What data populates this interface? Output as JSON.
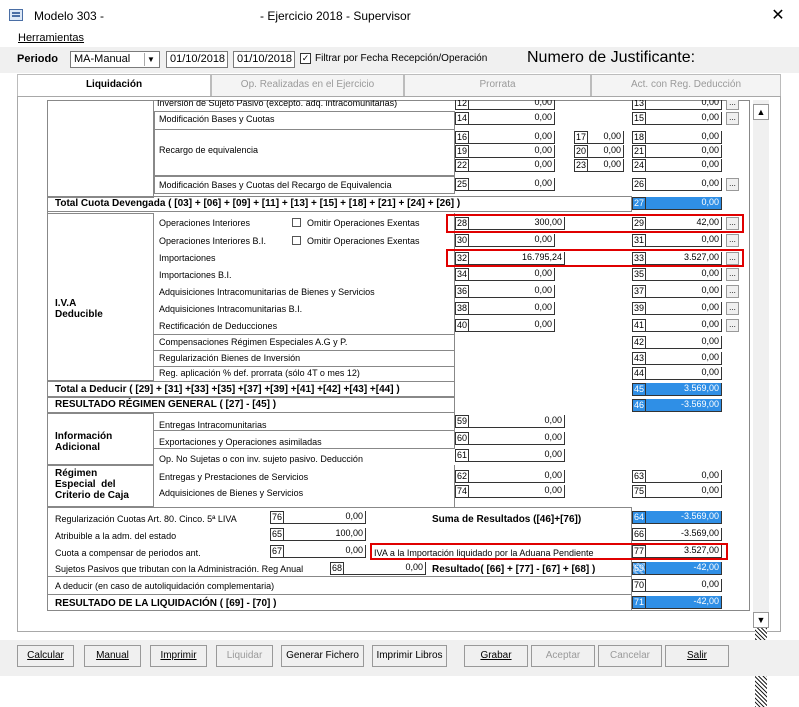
{
  "window": {
    "app_title": "Modelo 303 -",
    "title": "- Ejercicio 2018 - Supervisor",
    "close": "✕"
  },
  "menu": {
    "tools": "Herramientas"
  },
  "toolbar": {
    "period_label": "Periodo",
    "period_value": "MA-Manual",
    "date_from": "01/10/2018",
    "date_to": "01/10/2018",
    "filter_label": "Filtrar por Fecha Recepción/Operación",
    "filter_checked": "✓",
    "justificante_label": "Numero de Justificante:"
  },
  "tabs": [
    "Liquidación",
    "Op. Realizadas en el Ejercicio",
    "Prorrata",
    "Act. con Reg. Deducción"
  ],
  "rows": {
    "r1": {
      "label": "Inversión de Sujeto Pasivo (excepto. adq. intracomunitarias)",
      "a": "12",
      "av": "0,00",
      "b": "13",
      "bv": "0,00"
    },
    "r2": {
      "label": "Modificación Bases y Cuotas",
      "a": "14",
      "av": "0,00",
      "b": "15",
      "bv": "0,00"
    },
    "r3": {
      "label": "Recargo de equivalencia",
      "lines": [
        {
          "a": "16",
          "av": "0,00",
          "m": "17",
          "mv": "0,00",
          "b": "18",
          "bv": "0,00"
        },
        {
          "a": "19",
          "av": "0,00",
          "m": "20",
          "mv": "0,00",
          "b": "21",
          "bv": "0,00"
        },
        {
          "a": "22",
          "av": "0,00",
          "m": "23",
          "mv": "0,00",
          "b": "24",
          "bv": "0,00"
        }
      ]
    },
    "r4": {
      "label": "Modificación Bases y Cuotas del Recargo de Equivalencia",
      "a": "25",
      "av": "0,00",
      "b": "26",
      "bv": "0,00"
    },
    "total_dev": {
      "label": "Total Cuota Devengada ( [03] + [06] + [09] + [11] + [13] + [15] + [18] + [21] + [24] + [26] )",
      "b": "27",
      "bv": "0,00"
    },
    "ded_group": "I.V.A\nDeducible",
    "d1": {
      "label": "Operaciones Interiores",
      "omit": "Omitir Operaciones Exentas",
      "a": "28",
      "av": "300,00",
      "b": "29",
      "bv": "42,00"
    },
    "d2": {
      "label": "Operaciones Interiores B.I.",
      "omit": "Omitir Operaciones Exentas",
      "a": "30",
      "av": "0,00",
      "b": "31",
      "bv": "0,00"
    },
    "d3": {
      "label": "Importaciones",
      "a": "32",
      "av": "16.795,24",
      "b": "33",
      "bv": "3.527,00"
    },
    "d4": {
      "label": "Importaciones B.I.",
      "a": "34",
      "av": "0,00",
      "b": "35",
      "bv": "0,00"
    },
    "d5": {
      "label": "Adquisiciones Intracomunitarias de Bienes y Servicios",
      "a": "36",
      "av": "0,00",
      "b": "37",
      "bv": "0,00"
    },
    "d6": {
      "label": "Adquisiciones Intracomunitarias B.I.",
      "a": "38",
      "av": "0,00",
      "b": "39",
      "bv": "0,00"
    },
    "d7": {
      "label": "Rectificación de Deducciones",
      "a": "40",
      "av": "0,00",
      "b": "41",
      "bv": "0,00"
    },
    "d8": {
      "label": "Compensaciones Régimen Especiales A.G y P.",
      "b": "42",
      "bv": "0,00"
    },
    "d9": {
      "label": "Regularización Bienes de  Inversión",
      "b": "43",
      "bv": "0,00"
    },
    "d10": {
      "label": "Reg. aplicación % def. prorrata (sólo 4T o mes 12)",
      "b": "44",
      "bv": "0,00"
    },
    "total_ded": {
      "label": "Total a Deducir ( [29] + [31] +[33] +[35] +[37] +[39] +[41] +[42] +[43] +[44] )",
      "b": "45",
      "bv": "3.569,00"
    },
    "res_gen": {
      "label": "RESULTADO RÉGIMEN GENERAL ( [27] - [45] )",
      "b": "46",
      "bv": "-3.569,00"
    },
    "info_group": "Información\nAdicional",
    "i1": {
      "label": "Entregas Intracomunitarias",
      "a": "59",
      "av": "0,00"
    },
    "i2": {
      "label": "Exportaciones y Operaciones asimiladas",
      "a": "60",
      "av": "0,00"
    },
    "i3": {
      "label": "Op. No Sujetas o con inv. sujeto pasivo. Deducción",
      "a": "61",
      "av": "0,00"
    },
    "cash_group": "Régimen\nEspecial  del\nCriterio de Caja",
    "c1": {
      "label": "Entregas y Prestaciones de Servicios",
      "a": "62",
      "av": "0,00",
      "b": "63",
      "bv": "0,00"
    },
    "c2": {
      "label": "Adquisiciones de Bienes y Servicios",
      "a": "74",
      "av": "0,00",
      "b": "75",
      "bv": "0,00"
    },
    "f1": {
      "label": "Regularización Cuotas Art. 80. Cinco. 5ª LIVA",
      "a": "76",
      "av": "0,00",
      "sum_label": "Suma de Resultados ([46]+[76])",
      "b": "64",
      "bv": "-3.569,00"
    },
    "f2": {
      "label": "Atribuible a la adm. del estado",
      "a": "65",
      "av": "100,00",
      "b": "66",
      "bv": "-3.569,00"
    },
    "f3": {
      "label": "Cuota a compensar de periodos ant.",
      "a": "67",
      "av": "0,00",
      "mid_label": "IVA a la Importación liquidado por la Aduana Pendiente",
      "b": "77",
      "bv": "3.527,00"
    },
    "f4": {
      "label": "Sujetos Pasivos que tributan con la Administración. Reg Anual",
      "a": "68",
      "av": "0,00",
      "res_label": "Resultado( [66] + [77] - [67] + [68] )",
      "b": "69",
      "bv": "-42,00"
    },
    "f5": {
      "label": "A deducir (en caso de autoliquidación complementaria)",
      "b": "70",
      "bv": "0,00"
    },
    "f6": {
      "label": "RESULTADO DE LA LIQUIDACIÓN ( [69] - [70] )",
      "b": "71",
      "bv": "-42,00"
    }
  },
  "dots": "...",
  "scroll": {
    "up": "▲",
    "down": "▼"
  },
  "buttons": [
    "Calcular",
    "Manual",
    "Imprimir",
    "Liquidar",
    "Generar Fichero",
    "Imprimir Libros",
    "Grabar",
    "Aceptar",
    "Cancelar",
    "Salir"
  ],
  "colors": {
    "highlight": "#2f8fe6",
    "annotation": "#e00000"
  }
}
